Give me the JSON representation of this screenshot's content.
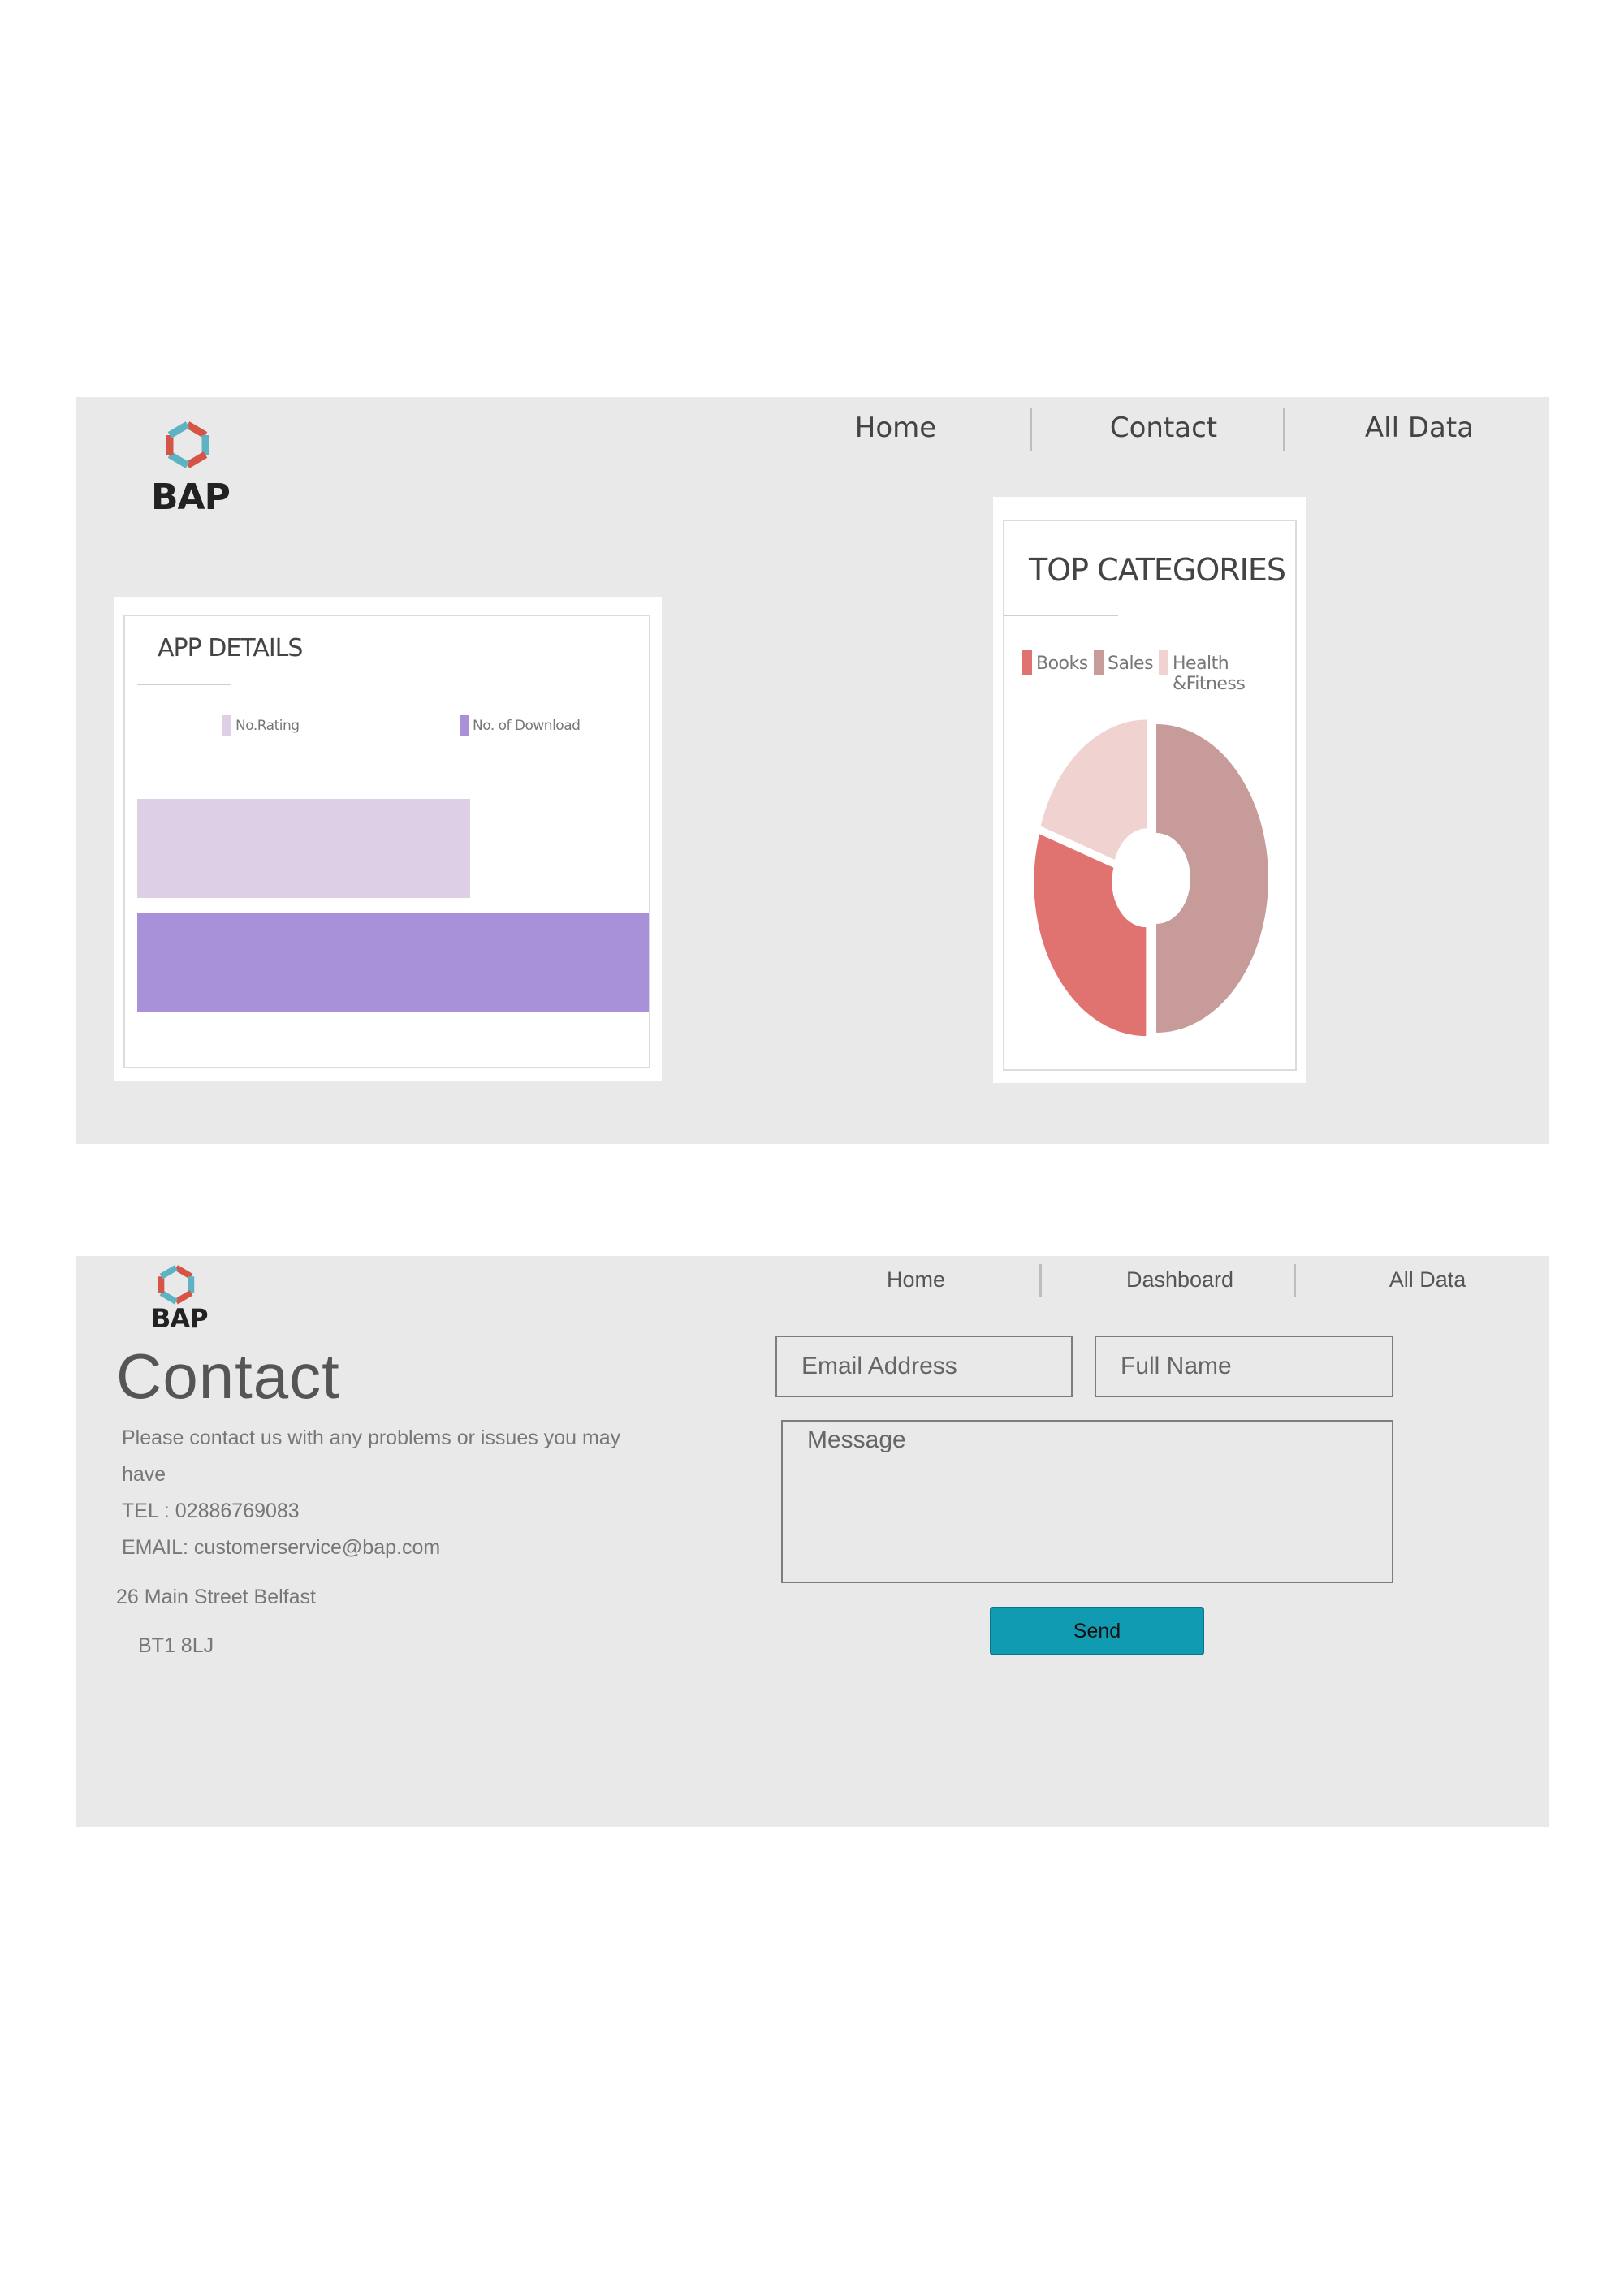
{
  "brand": {
    "name": "BAP"
  },
  "dashboard": {
    "nav": [
      {
        "label": "Home"
      },
      {
        "label": "Contact"
      },
      {
        "label": "All Data"
      }
    ],
    "app_details": {
      "title": "APP DETAILS",
      "chart_data": {
        "type": "bar",
        "orientation": "horizontal",
        "title": "APP DETAILS",
        "series": [
          {
            "name": "No.Rating",
            "color": "#dccfe6",
            "value": 0.65
          },
          {
            "name": "No. of Download",
            "color": "#a991da",
            "value": 1.0
          }
        ],
        "value_scale": "relative (fraction of widest bar)",
        "axes": "none shown",
        "legend": "top"
      }
    },
    "top_categories": {
      "title": "TOP CATEGORIES",
      "chart_data": {
        "type": "pie",
        "variant": "donut",
        "title": "TOP CATEGORIES",
        "slices": [
          {
            "label": "Books",
            "value": 30,
            "color": "#e07370"
          },
          {
            "label": "Sales",
            "value": 50,
            "color": "#c69b99"
          },
          {
            "label": "Health &Fitness",
            "value": 20,
            "color": "#f0d3d1"
          }
        ],
        "legend": "top"
      }
    }
  },
  "contact": {
    "nav": [
      {
        "label": "Home"
      },
      {
        "label": "Dashboard"
      },
      {
        "label": "All Data"
      }
    ],
    "title": "Contact",
    "intro_line1": "Please contact us with any problems or issues you may",
    "intro_line2": "have",
    "tel": "TEL : 02886769083",
    "email": "EMAIL: customerservice@bap.com",
    "address1": "26 Main Street Belfast",
    "address2": "BT1 8LJ",
    "form": {
      "email_placeholder": "Email Address",
      "name_placeholder": "Full Name",
      "message_placeholder": "Message",
      "send_label": "Send"
    }
  },
  "colors": {
    "panel_bg": "#e9e9e9",
    "send_button": "#109bb3",
    "logo_red": "#d65445",
    "logo_teal": "#5eb3c3"
  },
  "icons": [
    "bap-logo-icon"
  ]
}
